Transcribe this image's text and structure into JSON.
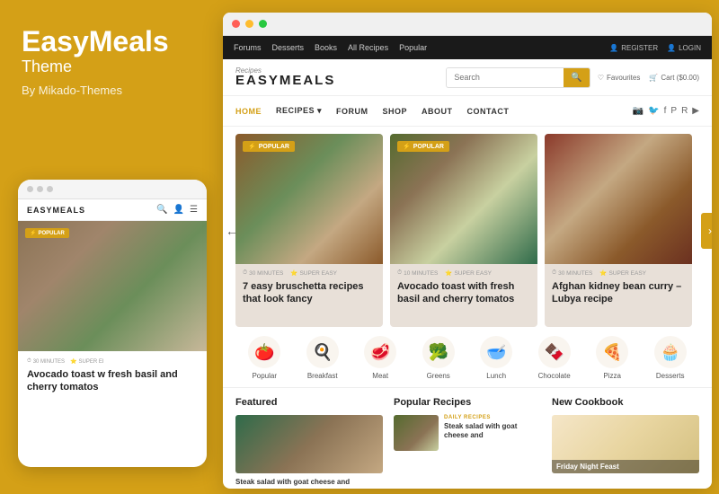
{
  "brand": {
    "name": "EasyMeals",
    "subtitle": "Theme",
    "by": "By Mikado-Themes"
  },
  "browser": {
    "dots": [
      "red",
      "yellow",
      "green"
    ]
  },
  "top_nav": {
    "items": [
      "Forums",
      "Desserts",
      "Books",
      "All Recipes",
      "Popular"
    ],
    "register_label": "REGISTER",
    "login_label": "LOGIN"
  },
  "logo": {
    "script": "Recipes",
    "name": "EASYMEALS"
  },
  "search": {
    "placeholder": "Search"
  },
  "header_actions": {
    "favourites": "Favourites",
    "cart": "Cart ($0.00)"
  },
  "main_nav": {
    "items": [
      "HOME",
      "RECIPES",
      "FORUM",
      "SHOP",
      "ABOUT",
      "CONTACT"
    ],
    "active": "HOME"
  },
  "badges": {
    "popular": "POPULAR"
  },
  "cards": [
    {
      "badge": "POPULAR",
      "minutes": "30 MINUTES",
      "difficulty": "SUPER EASY",
      "title": "7 easy bruschetta recipes that look fancy"
    },
    {
      "badge": "POPULAR",
      "minutes": "10 MINUTES",
      "difficulty": "SUPER EASY",
      "title": "Avocado toast with fresh basil and cherry tomatos"
    },
    {
      "badge": "",
      "minutes": "30 MINUTES",
      "difficulty": "SUPER EASY",
      "title": "Afghan kidney bean curry – Lubya recipe"
    }
  ],
  "categories": [
    {
      "label": "Popular",
      "icon": "🍅"
    },
    {
      "label": "Breakfast",
      "icon": "🍳"
    },
    {
      "label": "Meat",
      "icon": "🥩"
    },
    {
      "label": "Greens",
      "icon": "🥦"
    },
    {
      "label": "Lunch",
      "icon": "🥣"
    },
    {
      "label": "Chocolate",
      "icon": "🍫"
    },
    {
      "label": "Pizza",
      "icon": "🍕"
    },
    {
      "label": "Desserts",
      "icon": "🧁"
    }
  ],
  "sections": {
    "featured": {
      "title": "Featured",
      "text": "Steak salad with goat cheese and"
    },
    "popular_recipes": {
      "title": "Popular Recipes",
      "daily_tag": "DAILY RECIPES",
      "text": "Steak salad with goat cheese and"
    },
    "new_cookbook": {
      "title": "New Cookbook",
      "title_text": "Friday Night Feast"
    }
  },
  "mobile": {
    "brand": "EASYMEALS",
    "badge": "POPULAR",
    "minutes": "30 MINUTES",
    "difficulty": "SUPER EI",
    "title": "Avocado toast w fresh basil and cherry tomatos"
  }
}
